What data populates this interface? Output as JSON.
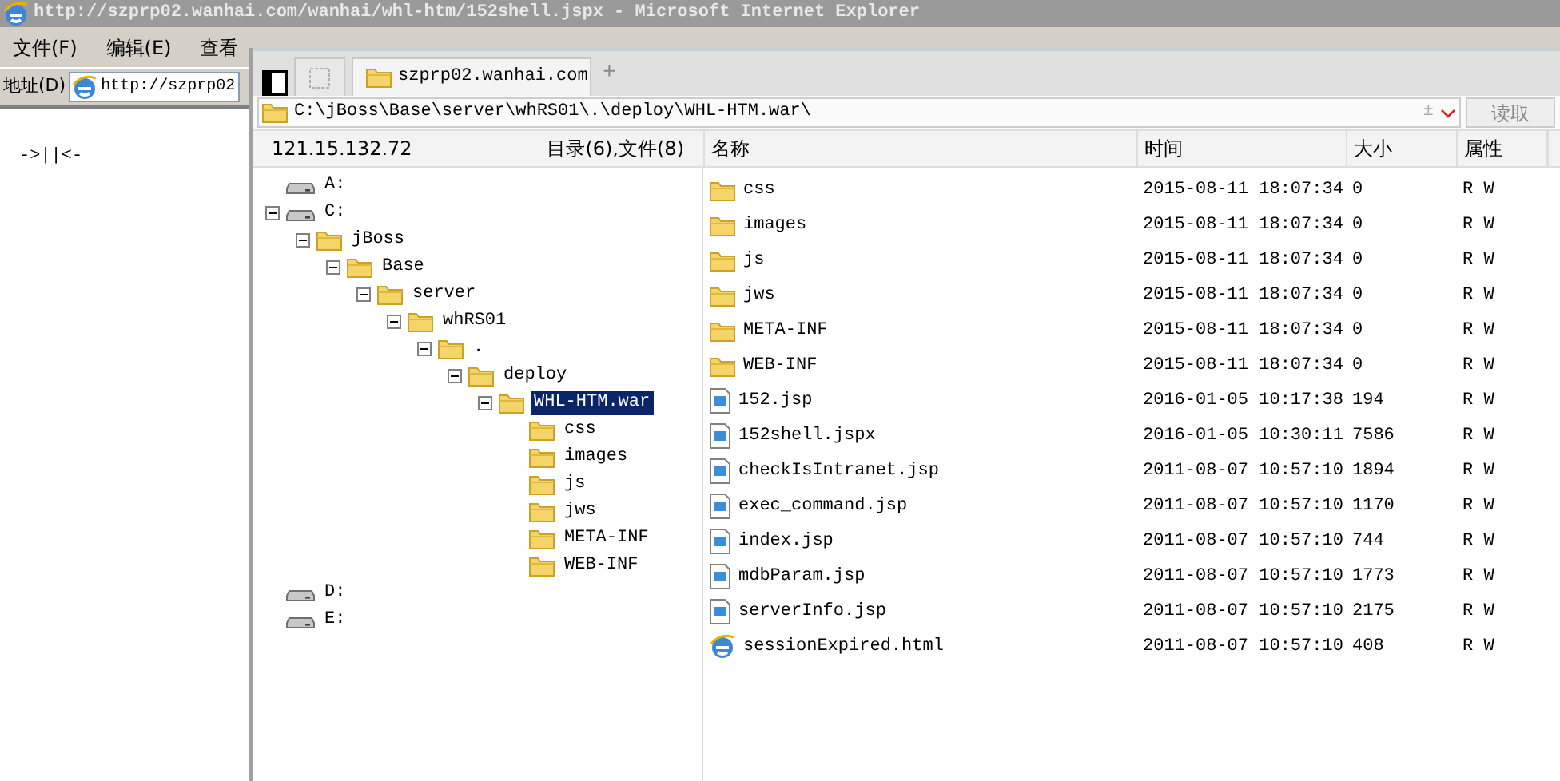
{
  "browser": {
    "title": "http://szprp02.wanhai.com/wanhai/whl-htm/152shell.jspx - Microsoft Internet Explorer",
    "menu": [
      "文件(F)",
      "编辑(E)",
      "查看"
    ],
    "address_label": "地址(D)",
    "address": "http://szprp02",
    "content": "->||<-"
  },
  "manager": {
    "tabs": [
      {
        "kind": "blank",
        "selected": false
      },
      {
        "label": "szprp02.wanhai.com",
        "kind": "folder",
        "selected": true
      }
    ],
    "new_tab": "+",
    "path": "C:\\jBoss\\Base\\server\\whRS01\\.\\deploy\\WHL-HTM.war\\",
    "path_toggle": "±",
    "read_button": "读取",
    "host": "121.15.132.72",
    "summary": "目录(6),文件(8)",
    "tree": [
      {
        "label": "A:",
        "kind": "drive",
        "selected": false
      },
      {
        "label": "C:",
        "kind": "drive",
        "expanded": true,
        "selected": false,
        "children": [
          {
            "label": "jBoss",
            "kind": "folder",
            "expanded": true,
            "selected": false,
            "children": [
              {
                "label": "Base",
                "kind": "folder",
                "expanded": true,
                "selected": false,
                "children": [
                  {
                    "label": "server",
                    "kind": "folder",
                    "expanded": true,
                    "selected": false,
                    "children": [
                      {
                        "label": "whRS01",
                        "kind": "folder",
                        "expanded": true,
                        "selected": false,
                        "children": [
                          {
                            "label": ".",
                            "kind": "folder",
                            "expanded": true,
                            "selected": false,
                            "children": [
                              {
                                "label": "deploy",
                                "kind": "folder",
                                "expanded": true,
                                "selected": false,
                                "children": [
                                  {
                                    "label": "WHL-HTM.war",
                                    "kind": "folder",
                                    "expanded": true,
                                    "selected": true,
                                    "children": [
                                      {
                                        "label": "css",
                                        "kind": "folder",
                                        "selected": false
                                      },
                                      {
                                        "label": "images",
                                        "kind": "folder",
                                        "selected": false
                                      },
                                      {
                                        "label": "js",
                                        "kind": "folder",
                                        "selected": false
                                      },
                                      {
                                        "label": "jws",
                                        "kind": "folder",
                                        "selected": false
                                      },
                                      {
                                        "label": "META-INF",
                                        "kind": "folder",
                                        "selected": false
                                      },
                                      {
                                        "label": "WEB-INF",
                                        "kind": "folder",
                                        "selected": false
                                      }
                                    ]
                                  }
                                ]
                              }
                            ]
                          }
                        ]
                      }
                    ]
                  }
                ]
              }
            ]
          }
        ]
      },
      {
        "label": "D:",
        "kind": "drive",
        "selected": false
      },
      {
        "label": "E:",
        "kind": "drive",
        "selected": false
      }
    ],
    "columns": [
      "名称",
      "时间",
      "大小",
      "属性"
    ],
    "files": [
      {
        "kind": "folder",
        "name": "css",
        "time": "2015-08-11 18:07:34",
        "size": "0",
        "attr": "R W"
      },
      {
        "kind": "folder",
        "name": "images",
        "time": "2015-08-11 18:07:34",
        "size": "0",
        "attr": "R W"
      },
      {
        "kind": "folder",
        "name": "js",
        "time": "2015-08-11 18:07:34",
        "size": "0",
        "attr": "R W"
      },
      {
        "kind": "folder",
        "name": "jws",
        "time": "2015-08-11 18:07:34",
        "size": "0",
        "attr": "R W"
      },
      {
        "kind": "folder",
        "name": "META-INF",
        "time": "2015-08-11 18:07:34",
        "size": "0",
        "attr": "R W"
      },
      {
        "kind": "folder",
        "name": "WEB-INF",
        "time": "2015-08-11 18:07:34",
        "size": "0",
        "attr": "R W"
      },
      {
        "kind": "file",
        "name": "152.jsp",
        "time": "2016-01-05 10:17:38",
        "size": "194",
        "attr": "R W"
      },
      {
        "kind": "file",
        "name": "152shell.jspx",
        "time": "2016-01-05 10:30:11",
        "size": "7586",
        "attr": "R W"
      },
      {
        "kind": "file",
        "name": "checkIsIntranet.jsp",
        "time": "2011-08-07 10:57:10",
        "size": "1894",
        "attr": "R W"
      },
      {
        "kind": "file",
        "name": "exec_command.jsp",
        "time": "2011-08-07 10:57:10",
        "size": "1170",
        "attr": "R W"
      },
      {
        "kind": "file",
        "name": "index.jsp",
        "time": "2011-08-07 10:57:10",
        "size": "744",
        "attr": "R W"
      },
      {
        "kind": "file",
        "name": "mdbParam.jsp",
        "time": "2011-08-07 10:57:10",
        "size": "1773",
        "attr": "R W"
      },
      {
        "kind": "file",
        "name": "serverInfo.jsp",
        "time": "2011-08-07 10:57:10",
        "size": "2175",
        "attr": "R W"
      },
      {
        "kind": "web",
        "name": "sessionExpired.html",
        "time": "2011-08-07 10:57:10",
        "size": "408",
        "attr": "R W"
      }
    ]
  }
}
